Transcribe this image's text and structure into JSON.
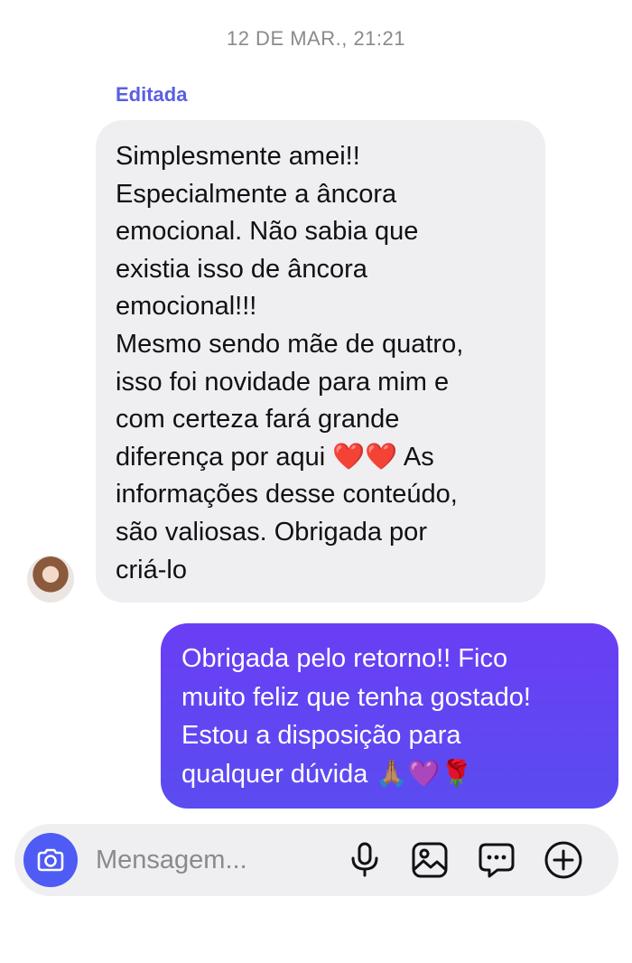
{
  "conversation": {
    "timestamp": "12 DE MAR., 21:21",
    "messages": [
      {
        "direction": "incoming",
        "edited_label": "Editada",
        "text": "Simplesmente amei!!\nEspecialmente a âncora\nemocional. Não sabia que\nexistia isso de âncora\nemocional!!!\nMesmo sendo mãe de quatro,\nisso foi novidade para mim e\ncom certeza fará grande\ndiferença por aqui ❤️❤️ As\ninformações desse conteúdo,\nsão valiosas. Obrigada por\ncriá-lo"
      },
      {
        "direction": "outgoing",
        "text": "Obrigada pelo retorno!! Fico\nmuito feliz que tenha gostado!\nEstou a disposição para\nqualquer dúvida 🙏🏽💜🌹"
      }
    ]
  },
  "composer": {
    "placeholder": "Mensagem...",
    "value": "",
    "icons": [
      "camera-icon",
      "microphone-icon",
      "image-gallery-icon",
      "sticker-icon",
      "add-icon"
    ]
  },
  "colors": {
    "accent": "#5b5fe3",
    "outgoing_bubble": "#6a3ef5",
    "incoming_bubble": "#efeff2"
  }
}
